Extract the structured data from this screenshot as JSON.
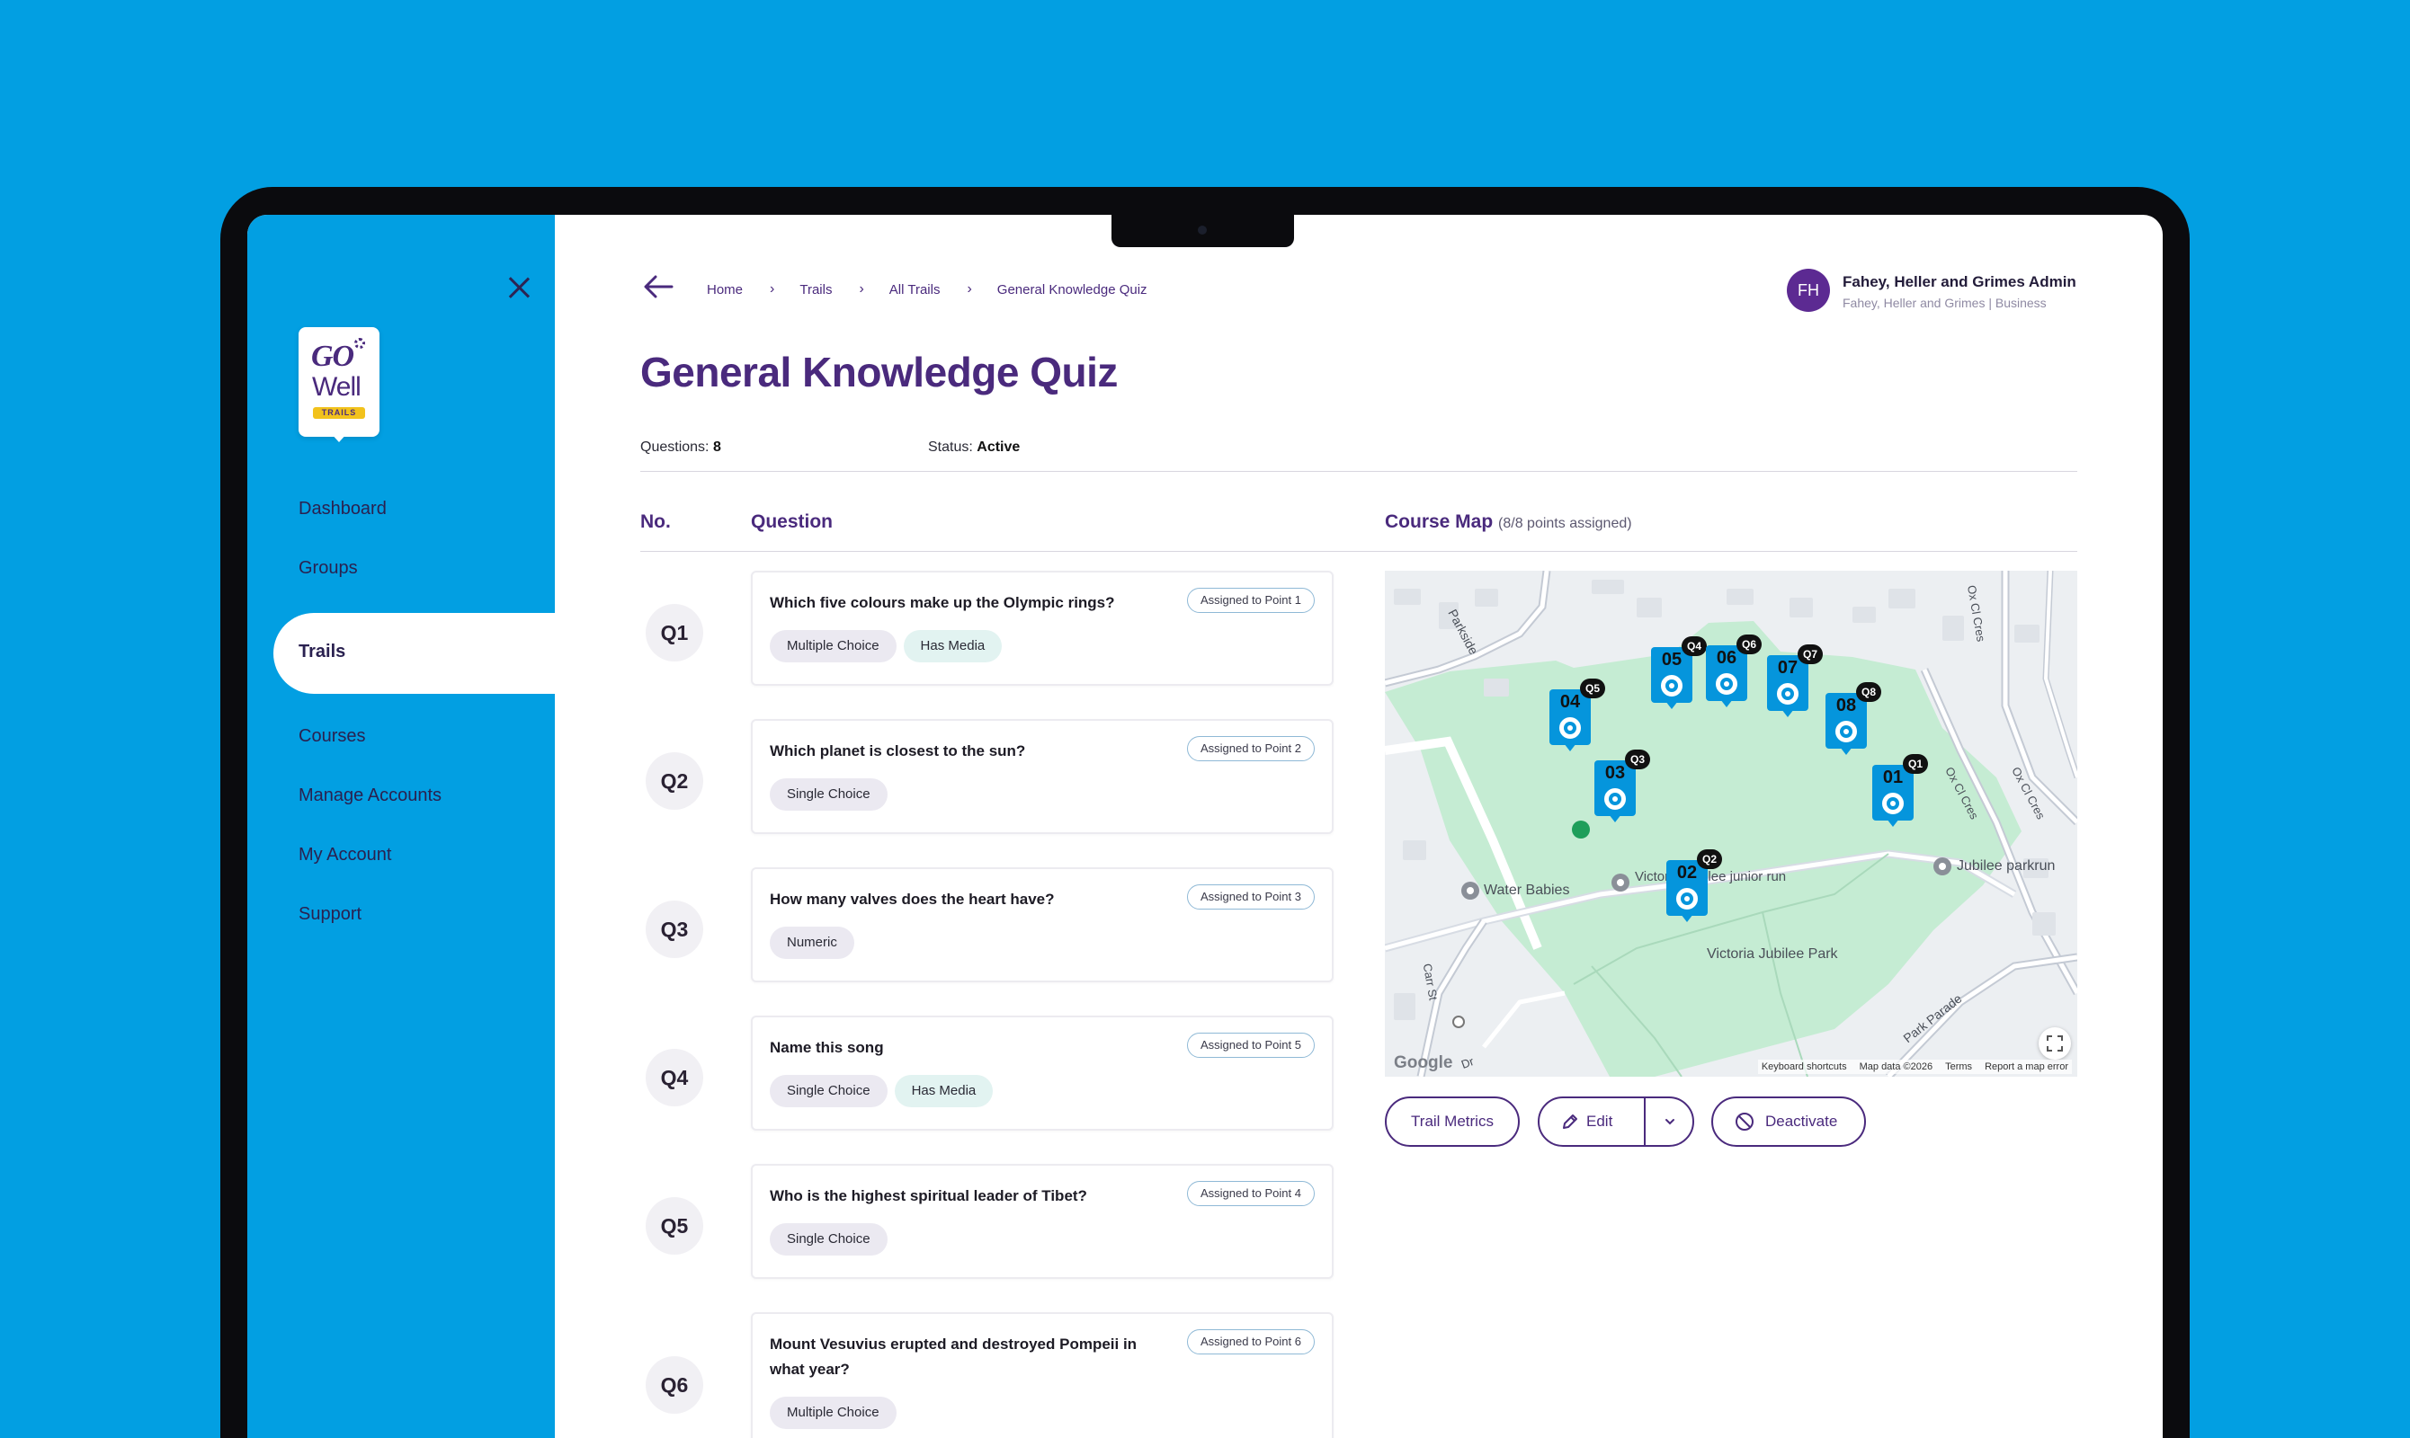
{
  "sidebar": {
    "nav": [
      "Dashboard",
      "Groups",
      "Trails",
      "Courses",
      "Manage Accounts",
      "My Account",
      "Support"
    ],
    "logo": {
      "line1": "GO",
      "line2": "Well",
      "badge": "TRAILS"
    }
  },
  "breadcrumb": [
    "Home",
    "Trails",
    "All Trails",
    "General Knowledge Quiz"
  ],
  "user": {
    "initials": "FH",
    "name": "Fahey, Heller and Grimes Admin",
    "subtitle": "Fahey, Heller and Grimes | Business"
  },
  "page": {
    "title": "General Knowledge Quiz",
    "questions_label": "Questions:",
    "questions_count": "8",
    "status_label": "Status:",
    "status_value": "Active"
  },
  "columns": {
    "no": "No.",
    "question": "Question",
    "map": "Course Map",
    "map_sub": "(8/8 points assigned)"
  },
  "questions": [
    {
      "no": "Q1",
      "text": "Which five colours make up the Olympic rings?",
      "assigned": "Assigned to Point 1",
      "tags": [
        "Multiple Choice",
        "Has Media"
      ]
    },
    {
      "no": "Q2",
      "text": "Which planet is closest to the sun?",
      "assigned": "Assigned to Point 2",
      "tags": [
        "Single Choice"
      ]
    },
    {
      "no": "Q3",
      "text": "How many valves does the heart have?",
      "assigned": "Assigned to Point 3",
      "tags": [
        "Numeric"
      ]
    },
    {
      "no": "Q4",
      "text": "Name this song",
      "assigned": "Assigned to Point 5",
      "tags": [
        "Single Choice",
        "Has Media"
      ]
    },
    {
      "no": "Q5",
      "text": "Who is the highest spiritual leader of Tibet?",
      "assigned": "Assigned to Point 4",
      "tags": [
        "Single Choice"
      ]
    },
    {
      "no": "Q6",
      "text": "Mount Vesuvius erupted and destroyed Pompeii in what year?",
      "assigned": "Assigned to Point 6",
      "tags": [
        "Multiple Choice"
      ]
    }
  ],
  "map": {
    "labels": {
      "parkside": "Parkside",
      "water_babies": "Water Babies",
      "victoria_junior": "Victoria Jubilee junior run",
      "victoria_park": "Victoria Jubilee Park",
      "jubilee_parkrun": "Jubilee parkrun",
      "ox_cl_cres_1": "Ox Cl Cres",
      "ox_cl_cres_2": "Ox Cl Cres",
      "ox_cl_cres_3": "Ox Cl Cres",
      "park_parade": "Park Parade",
      "carr_st": "Carr St",
      "dr": "Dr"
    },
    "google": "Google",
    "footer": [
      "Keyboard shortcuts",
      "Map data ©2026",
      "Terms",
      "Report a map error"
    ],
    "pins": [
      {
        "num": "01",
        "badge": "Q1"
      },
      {
        "num": "02",
        "badge": "Q2"
      },
      {
        "num": "03",
        "badge": "Q3"
      },
      {
        "num": "04",
        "badge": "Q5"
      },
      {
        "num": "05",
        "badge": "Q4"
      },
      {
        "num": "06",
        "badge": "Q6"
      },
      {
        "num": "07",
        "badge": "Q7"
      },
      {
        "num": "08",
        "badge": "Q8"
      }
    ]
  },
  "actions": {
    "metrics": "Trail Metrics",
    "edit": "Edit",
    "deactivate": "Deactivate"
  },
  "colors": {
    "brand_blue": "#029fe2",
    "brand_purple": "#4a2a7d",
    "pin_blue": "#0595dc",
    "park_green": "#bfe8cf"
  }
}
